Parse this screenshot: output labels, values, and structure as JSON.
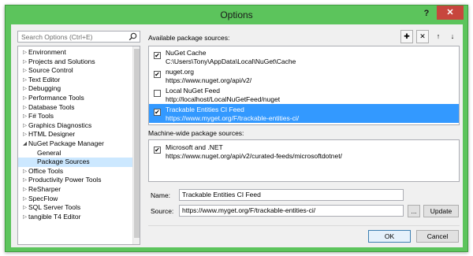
{
  "window": {
    "title": "Options",
    "help_label": "?",
    "close_label": "✕"
  },
  "search": {
    "placeholder": "Search Options (Ctrl+E)"
  },
  "tree": {
    "items": [
      {
        "label": "Environment",
        "arrow": "▷"
      },
      {
        "label": "Projects and Solutions",
        "arrow": "▷"
      },
      {
        "label": "Source Control",
        "arrow": "▷"
      },
      {
        "label": "Text Editor",
        "arrow": "▷"
      },
      {
        "label": "Debugging",
        "arrow": "▷"
      },
      {
        "label": "Performance Tools",
        "arrow": "▷"
      },
      {
        "label": "Database Tools",
        "arrow": "▷"
      },
      {
        "label": "F# Tools",
        "arrow": "▷"
      },
      {
        "label": "Graphics Diagnostics",
        "arrow": "▷"
      },
      {
        "label": "HTML Designer",
        "arrow": "▷"
      },
      {
        "label": "NuGet Package Manager",
        "arrow": "◢"
      },
      {
        "label": "General",
        "arrow": ""
      },
      {
        "label": "Package Sources",
        "arrow": ""
      },
      {
        "label": "Office Tools",
        "arrow": "▷"
      },
      {
        "label": "Productivity Power Tools",
        "arrow": "▷"
      },
      {
        "label": "ReSharper",
        "arrow": "▷"
      },
      {
        "label": "SpecFlow",
        "arrow": "▷"
      },
      {
        "label": "SQL Server Tools",
        "arrow": "▷"
      },
      {
        "label": "tangible T4 Editor",
        "arrow": "▷"
      }
    ]
  },
  "available": {
    "label": "Available package sources:",
    "sources": [
      {
        "name": "NuGet Cache",
        "url": "C:\\Users\\Tony\\AppData\\Local\\NuGet\\Cache",
        "checked": "✔"
      },
      {
        "name": "nuget.org",
        "url": "https://www.nuget.org/api/v2/",
        "checked": "✔"
      },
      {
        "name": "Local NuGet Feed",
        "url": "http://localhost/LocalNuGetFeed/nuget",
        "checked": ""
      },
      {
        "name": "Trackable Entities CI Feed",
        "url": "https://www.myget.org/F/trackable-entities-ci/",
        "checked": "✔"
      }
    ]
  },
  "toolbar": {
    "add_label": "✚",
    "remove_label": "✕",
    "up_label": "↑",
    "down_label": "↓"
  },
  "machine_wide": {
    "label": "Machine-wide package sources:",
    "sources": [
      {
        "name": "Microsoft and .NET",
        "url": "https://www.nuget.org/api/v2/curated-feeds/microsoftdotnet/",
        "checked": "✔"
      }
    ]
  },
  "form": {
    "name_label": "Name:",
    "name_value": "Trackable Entities CI Feed",
    "source_label": "Source:",
    "source_value": "https://www.myget.org/F/trackable-entities-ci/",
    "browse_label": "...",
    "update_label": "Update"
  },
  "footer": {
    "ok_label": "OK",
    "cancel_label": "Cancel"
  },
  "colors": {
    "title_bar": "#5cc45c",
    "selection": "#3399ff",
    "close": "#c7463d"
  }
}
